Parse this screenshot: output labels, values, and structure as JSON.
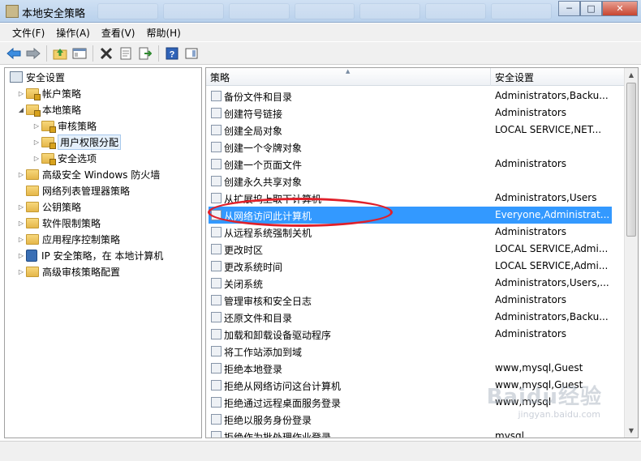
{
  "window": {
    "title": "本地安全策略"
  },
  "menu": [
    {
      "label": "文件(F)"
    },
    {
      "label": "操作(A)"
    },
    {
      "label": "查看(V)"
    },
    {
      "label": "帮助(H)"
    }
  ],
  "tree": [
    {
      "label": "安全设置",
      "level": 0,
      "arrow": "",
      "icon": "root"
    },
    {
      "label": "帐户策略",
      "level": 1,
      "arrow": "▷",
      "icon": "folder-lock"
    },
    {
      "label": "本地策略",
      "level": 1,
      "arrow": "◢",
      "icon": "folder-lock"
    },
    {
      "label": "审核策略",
      "level": 2,
      "arrow": "▷",
      "icon": "folder-lock"
    },
    {
      "label": "用户权限分配",
      "level": 2,
      "arrow": "▷",
      "icon": "folder-lock",
      "selected": true
    },
    {
      "label": "安全选项",
      "level": 2,
      "arrow": "▷",
      "icon": "folder-lock"
    },
    {
      "label": "高级安全 Windows 防火墙",
      "level": 1,
      "arrow": "▷",
      "icon": "folder"
    },
    {
      "label": "网络列表管理器策略",
      "level": 1,
      "arrow": "",
      "icon": "folder"
    },
    {
      "label": "公钥策略",
      "level": 1,
      "arrow": "▷",
      "icon": "folder"
    },
    {
      "label": "软件限制策略",
      "level": 1,
      "arrow": "▷",
      "icon": "folder"
    },
    {
      "label": "应用程序控制策略",
      "level": 1,
      "arrow": "▷",
      "icon": "folder"
    },
    {
      "label": "IP 安全策略，在 本地计算机",
      "level": 1,
      "arrow": "▷",
      "icon": "ip"
    },
    {
      "label": "高级审核策略配置",
      "level": 1,
      "arrow": "▷",
      "icon": "folder"
    }
  ],
  "table": {
    "columns": [
      "策略",
      "安全设置"
    ],
    "rows": [
      {
        "name": "备份文件和目录",
        "setting": "Administrators,Backu..."
      },
      {
        "name": "创建符号链接",
        "setting": "Administrators"
      },
      {
        "name": "创建全局对象",
        "setting": "LOCAL SERVICE,NET..."
      },
      {
        "name": "创建一个令牌对象",
        "setting": ""
      },
      {
        "name": "创建一个页面文件",
        "setting": "Administrators"
      },
      {
        "name": "创建永久共享对象",
        "setting": ""
      },
      {
        "name": "从扩展坞上取下计算机",
        "setting": "Administrators,Users"
      },
      {
        "name": "从网络访问此计算机",
        "setting": "Everyone,Administrat...",
        "selected": true
      },
      {
        "name": "从远程系统强制关机",
        "setting": "Administrators"
      },
      {
        "name": "更改时区",
        "setting": "LOCAL SERVICE,Admi..."
      },
      {
        "name": "更改系统时间",
        "setting": "LOCAL SERVICE,Admi..."
      },
      {
        "name": "关闭系统",
        "setting": "Administrators,Users,..."
      },
      {
        "name": "管理审核和安全日志",
        "setting": "Administrators"
      },
      {
        "name": "还原文件和目录",
        "setting": "Administrators,Backu..."
      },
      {
        "name": "加载和卸载设备驱动程序",
        "setting": "Administrators"
      },
      {
        "name": "将工作站添加到域",
        "setting": ""
      },
      {
        "name": "拒绝本地登录",
        "setting": "www,mysql,Guest"
      },
      {
        "name": "拒绝从网络访问这台计算机",
        "setting": "www,mysql,Guest"
      },
      {
        "name": "拒绝通过远程桌面服务登录",
        "setting": "www,mysql"
      },
      {
        "name": "拒绝以服务身份登录",
        "setting": ""
      },
      {
        "name": "拒绝作为批处理作业登录",
        "setting": "mysql"
      }
    ]
  },
  "watermark": {
    "logo": "Baidu经验",
    "url": "jingyan.baidu.com"
  }
}
